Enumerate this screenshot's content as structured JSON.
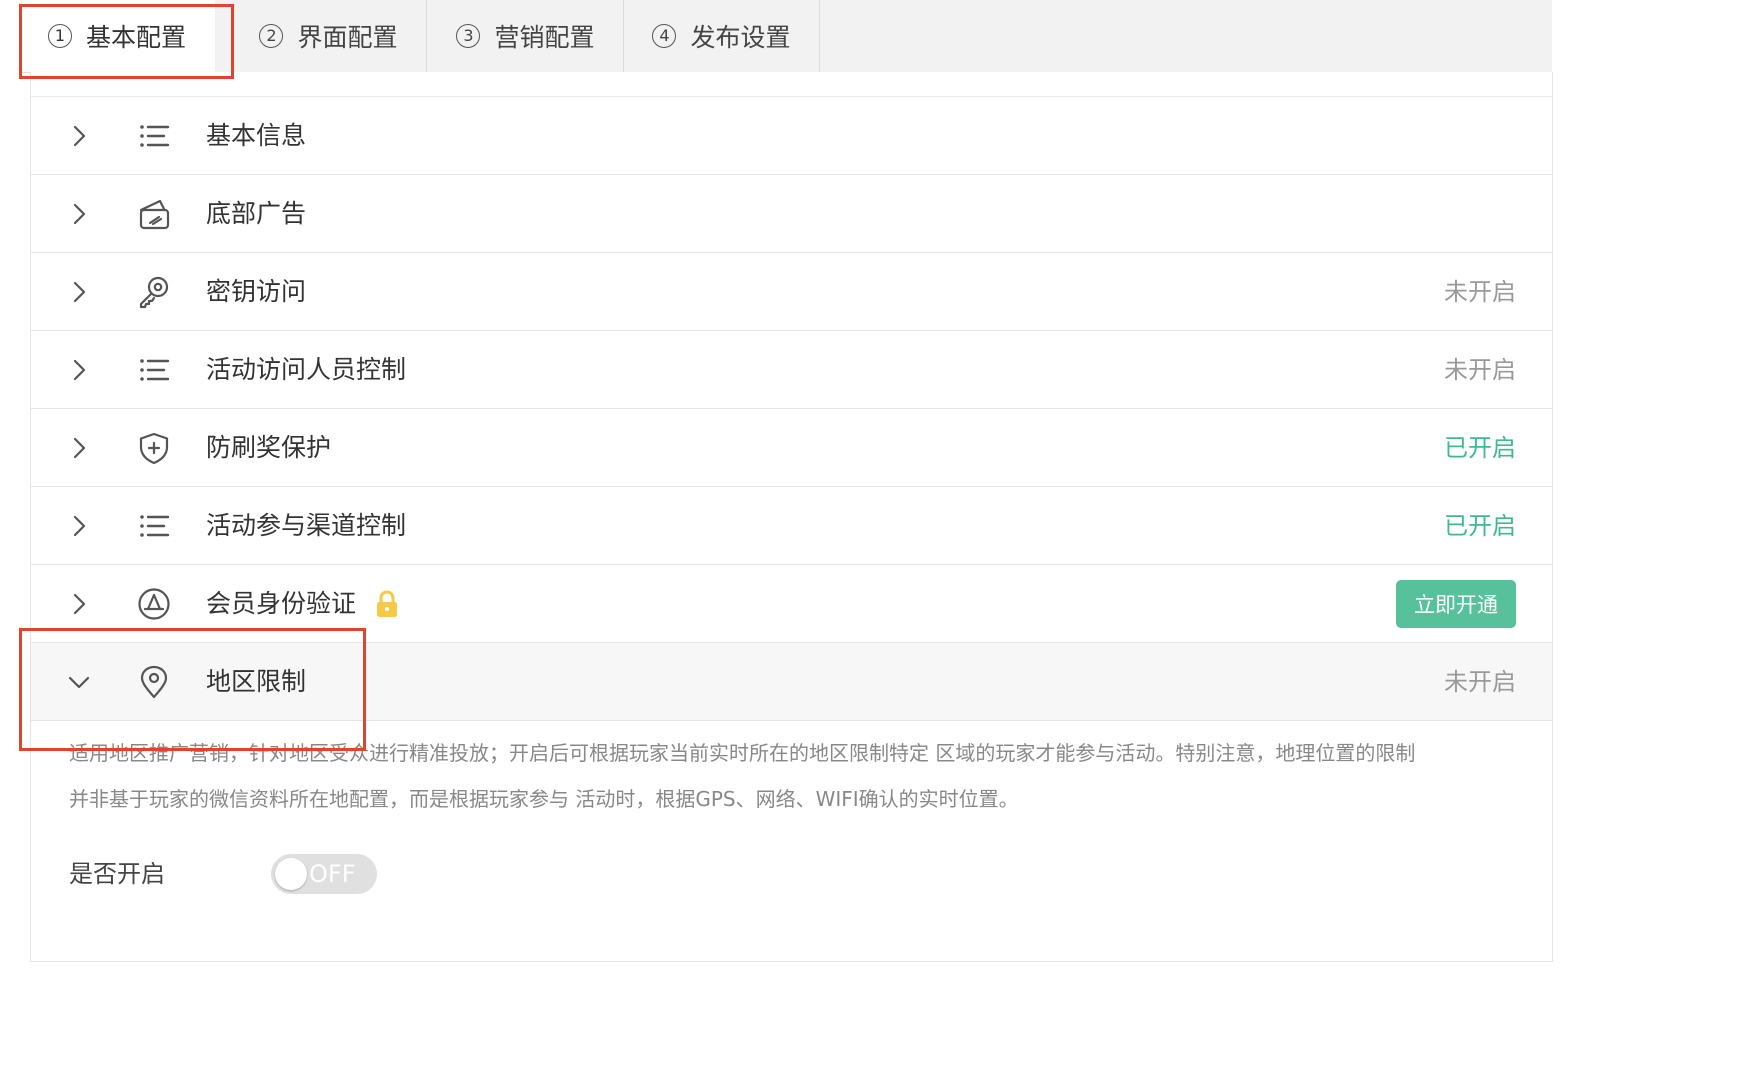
{
  "tabs": [
    {
      "num": "1",
      "label": "基本配置"
    },
    {
      "num": "2",
      "label": "界面配置"
    },
    {
      "num": "3",
      "label": "营销配置"
    },
    {
      "num": "4",
      "label": "发布设置"
    }
  ],
  "rows": [
    {
      "label": "基本信息",
      "icon": "list-icon",
      "status": ""
    },
    {
      "label": "底部广告",
      "icon": "ad-card-icon",
      "status": ""
    },
    {
      "label": "密钥访问",
      "icon": "key-icon",
      "status": "未开启"
    },
    {
      "label": "活动访问人员控制",
      "icon": "list-icon",
      "status": "未开启"
    },
    {
      "label": "防刷奖保护",
      "icon": "shield-plus-icon",
      "status": "已开启"
    },
    {
      "label": "活动参与渠道控制",
      "icon": "list-icon",
      "status": "已开启"
    },
    {
      "label": "会员身份验证",
      "icon": "member-badge-icon",
      "locked": true,
      "action_label": "立即开通"
    },
    {
      "label": "地区限制",
      "icon": "location-pin-icon",
      "status": "未开启",
      "expanded": true
    }
  ],
  "region_detail": {
    "description_line1": "适用地区推广营销，针对地区受众进行精准投放；开启后可根据玩家当前实时所在的地区限制特定 区域的玩家才能参与活动。特别注意，地理位置的限制",
    "description_line2": "并非基于玩家的微信资料所在地配置，而是根据玩家参与 活动时，根据GPS、网络、WIFI确认的实时位置。",
    "switch_label": "是否开启",
    "switch_text": "OFF"
  },
  "colors": {
    "accent_green": "#56c19a",
    "status_on": "#3dbb8f",
    "status_off": "#999999",
    "highlight_red": "#e0432f"
  }
}
